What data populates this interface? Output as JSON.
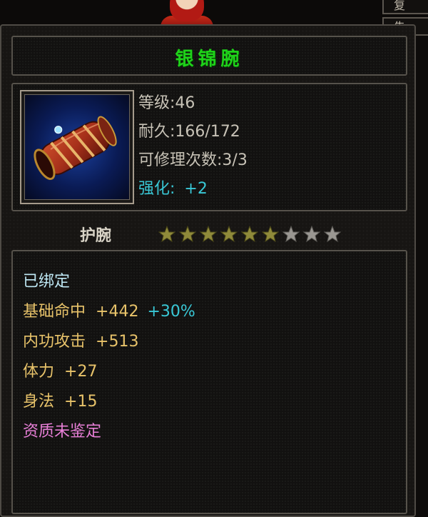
{
  "item": {
    "name": "银锦腕",
    "icon": "bracer-icon",
    "stats": {
      "level": "等级:46",
      "durability": "耐久:166/172",
      "repairs": "可修理次数:3/3",
      "enhance_label": "强化:",
      "enhance_value": "+2"
    },
    "type": "护腕",
    "stars": {
      "total": 9,
      "filled": 6
    },
    "attributes": [
      {
        "label": "已绑定",
        "value": "",
        "extra": "",
        "color": "#bfe8f4"
      },
      {
        "label": "基础命中",
        "value": "+442",
        "extra": "+30%",
        "color": "#e8c36a"
      },
      {
        "label": "内功攻击",
        "value": "+513",
        "extra": "",
        "color": "#e8c36a"
      },
      {
        "label": "体力",
        "value": "+27",
        "extra": "",
        "color": "#e8c36a"
      },
      {
        "label": "身法",
        "value": "+15",
        "extra": "",
        "color": "#e8c36a"
      },
      {
        "label": "资质未鉴定",
        "value": "",
        "extra": "",
        "color": "#e77fd6"
      }
    ]
  },
  "side_tabs": [
    "复",
    "告"
  ],
  "colors": {
    "title": "#1fd31a",
    "enhance": "#39c8d6",
    "extra_pct": "#39c8d6",
    "star_filled": "#8f8a3a",
    "star_empty": "#9a9792"
  }
}
